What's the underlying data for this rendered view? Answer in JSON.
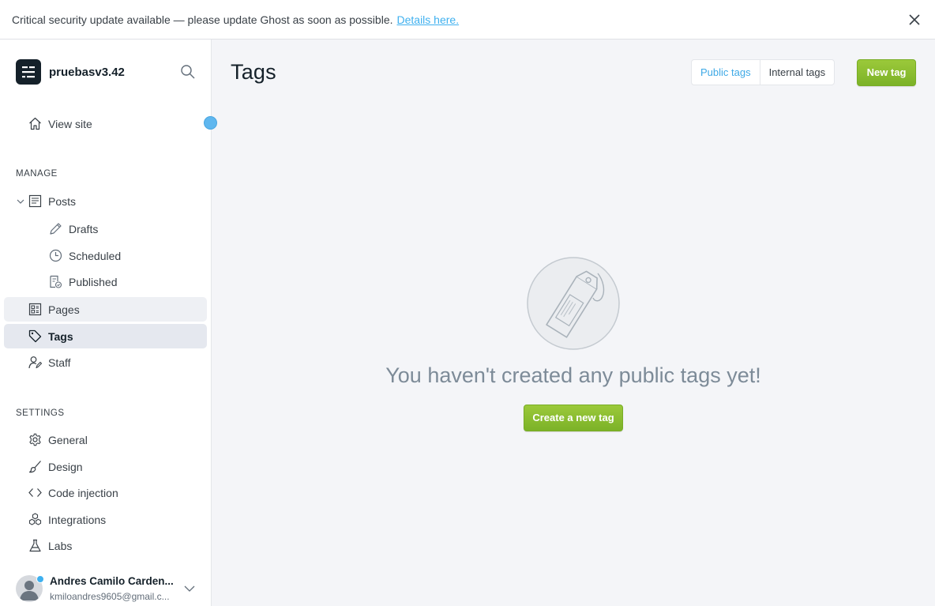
{
  "banner": {
    "message": "Critical security update available — please update Ghost as soon as possible.",
    "link": "Details here."
  },
  "site": {
    "name": "pruebasv3.42"
  },
  "nav": {
    "view_site": "View site",
    "manage_header": "MANAGE",
    "posts": "Posts",
    "drafts": "Drafts",
    "scheduled": "Scheduled",
    "published": "Published",
    "pages": "Pages",
    "tags": "Tags",
    "staff": "Staff",
    "settings_header": "SETTINGS",
    "general": "General",
    "design": "Design",
    "code_injection": "Code injection",
    "integrations": "Integrations",
    "labs": "Labs"
  },
  "user": {
    "name": "Andres Camilo Carden...",
    "email": "kmiloandres9605@gmail.c..."
  },
  "main": {
    "title": "Tags",
    "tabs": [
      "Public tags",
      "Internal tags"
    ],
    "active_tab": "Public tags",
    "new_tag": "New tag",
    "empty_message": "You haven't created any public tags yet!",
    "create_button": "Create a new tag"
  },
  "colors": {
    "accent_blue": "#3eb0ef",
    "green": "#8cbf30",
    "sidebar_active": "#e5e8ef"
  },
  "icons": {
    "close": "close-icon",
    "search": "search-icon",
    "home": "home-icon",
    "posts": "posts-icon",
    "drafts": "pencil-icon",
    "scheduled": "clock-icon",
    "published": "published-icon",
    "pages": "pages-icon",
    "tags": "tag-icon",
    "staff": "staff-icon",
    "general": "gear-icon",
    "design": "brush-icon",
    "code": "code-icon",
    "integrations": "integrations-icon",
    "labs": "flask-icon"
  }
}
